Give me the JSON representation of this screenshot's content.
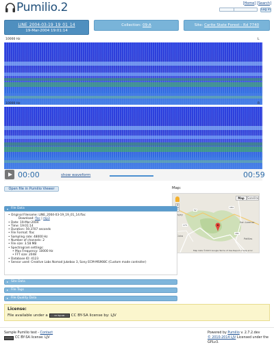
{
  "header": {
    "app_name": "Pumilio.2",
    "links": {
      "open_bracket": "[",
      "home": "Home",
      "sep": "] [",
      "search": "Search",
      "close_bracket": "]"
    },
    "login_label": "Log in"
  },
  "tabs": {
    "file_name": "LINE_2004-03-19_19_01_14",
    "file_datetime": "19-Mar-2004 19:01:14",
    "collection_prefix": "Collection: ",
    "collection_value": "09-A",
    "site_prefix": "Site: ",
    "site_value": "Carite State Forest - Rd 7740"
  },
  "spectrograms": [
    {
      "freq_label": "10000 Hz",
      "channel": "L"
    },
    {
      "freq_label": "10000 Hz",
      "channel": "R"
    }
  ],
  "player": {
    "current_time": "00:00",
    "show_waveform": "show waveform",
    "total_time": "00:59",
    "progress": 0.0
  },
  "open_button": "Open file in Pumilio Viewer",
  "map": {
    "label": "Map:",
    "type_map": "Map",
    "type_satellite": "Satellite",
    "attribution": "Map data ©2015 Google   Terms of Use   Report a map error",
    "place_labels": [
      "Cayey",
      "Cidra",
      "San Lorenzo",
      "Patillas"
    ],
    "road_labels": [
      "52",
      "173",
      "184",
      "181"
    ]
  },
  "accordion": {
    "file_data": "File Data",
    "site_data": "Site Data",
    "file_tags": "File Tags",
    "file_quality": "File Quality Data"
  },
  "file_data": {
    "original_filename": "Original Filename: LINE_2004-03-19_19_01_14.flac",
    "download_prefix": "Download: ",
    "download_flac": "flac",
    "download_sep": " | ",
    "download_mp3": "mp3",
    "date": "Date: 19-Mar-2004",
    "time": "Time: 19:01:14",
    "duration": "Duration: 59.3707 seconds",
    "format": "File Format: flac",
    "sampling_rate": "Sampling rate: 48000 Hz",
    "channels": "Number of channels: 2",
    "file_size": "File size: 3.58 MB",
    "spec_settings": "Spectrogram settings:",
    "max_freq": "Max Frequency: 10000 Hz",
    "fft_size": "FFT size: 2048",
    "database_id": "Database ID: 4123",
    "sensor": "Sensor used: Creative Labs Nomad Jukebox 3, Sony ECM-MS908C (Custom made controller)"
  },
  "license": {
    "title": "License:",
    "text_before": "File available under a",
    "badge": "cc by-sa",
    "text_after": "CC BY-SA license by: LJV"
  },
  "footer": {
    "left_line1_text": "Sample Pumilio test - ",
    "left_line1_link": "Contact",
    "left_line2": "CC BY-SA license: LJV",
    "right_line1_text": "Powered by ",
    "right_line1_link": "Pumilio",
    "right_line1_version": " v. 2.7.2.dev",
    "right_line2_link": "© 2010-2014 LJV",
    "right_line2_text": " Licensed under the GPLv3."
  },
  "colors": {
    "accent": "#4f8fbf",
    "tab_light": "#79b4d9",
    "time_text": "#2b6aa8",
    "license_bg": "#fbf6cd"
  }
}
